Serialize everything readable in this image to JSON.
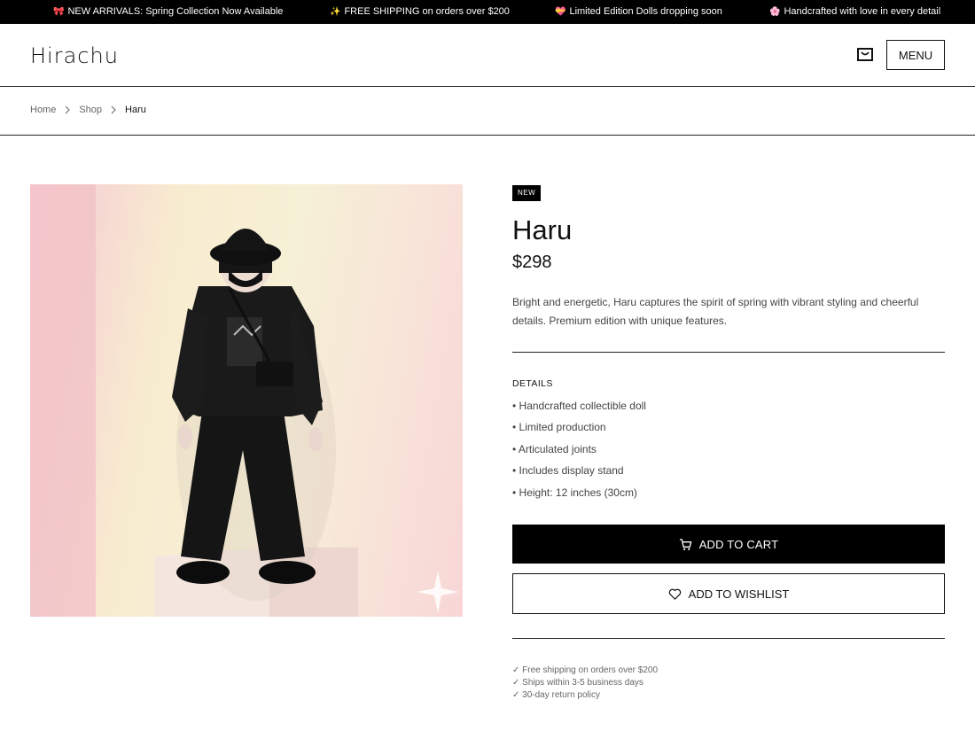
{
  "announcements": [
    {
      "emoji": "🎀",
      "text": "NEW ARRIVALS: Spring Collection Now Available"
    },
    {
      "emoji": "✨",
      "text": "FREE SHIPPING on orders over $200"
    },
    {
      "emoji": "💝",
      "text": "Limited Edition Dolls dropping soon"
    },
    {
      "emoji": "🌸",
      "text": "Handcrafted with love in every detail"
    }
  ],
  "header": {
    "logo": "Hirachu",
    "cart_icon": "shopping-bag-icon",
    "menu_label": "MENU"
  },
  "breadcrumb": {
    "items": [
      "Home",
      "Shop",
      "Haru"
    ],
    "separator_icon": "chevron-right-icon"
  },
  "product": {
    "badge": "NEW",
    "name": "Haru",
    "price": "$298",
    "description": "Bright and energetic, Haru captures the spirit of spring with vibrant styling and cheerful details. Premium edition with unique features.",
    "details_heading": "DETAILS",
    "details": [
      "• Handcrafted collectible doll",
      "• Limited production",
      "• Articulated joints",
      "• Includes display stand",
      "• Height: 12 inches (30cm)"
    ],
    "add_to_cart_label": "ADD TO CART",
    "add_to_cart_icon": "cart-icon",
    "add_to_wishlist_label": "ADD TO WISHLIST",
    "add_to_wishlist_icon": "heart-icon",
    "perks": [
      "✓ Free shipping on orders over $200",
      "✓ Ships within 3-5 business days",
      "✓ 30-day return policy"
    ]
  },
  "colors": {
    "announcement_bg": "#000000",
    "primary_button": "#000000",
    "text": "#111111",
    "muted_text": "#666666"
  }
}
